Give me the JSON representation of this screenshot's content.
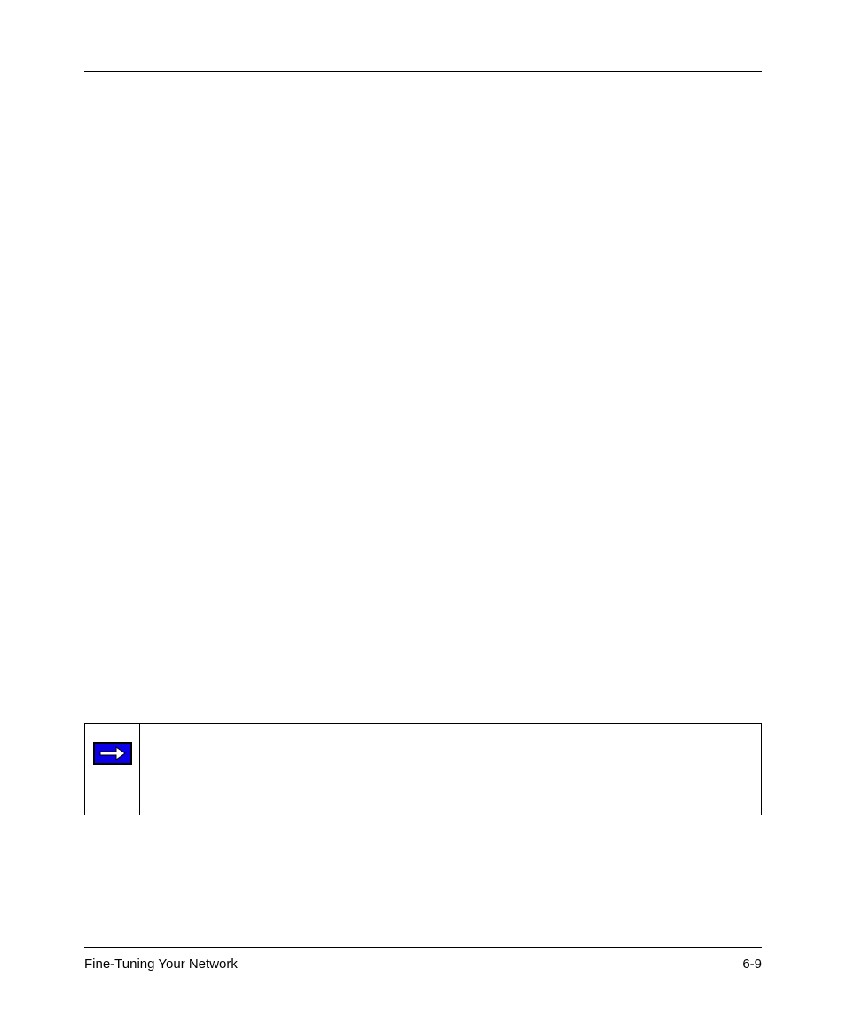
{
  "footer": {
    "left": "Fine-Tuning Your Network",
    "right": "6-9"
  },
  "note": {
    "icon_name": "arrow-right-icon"
  }
}
